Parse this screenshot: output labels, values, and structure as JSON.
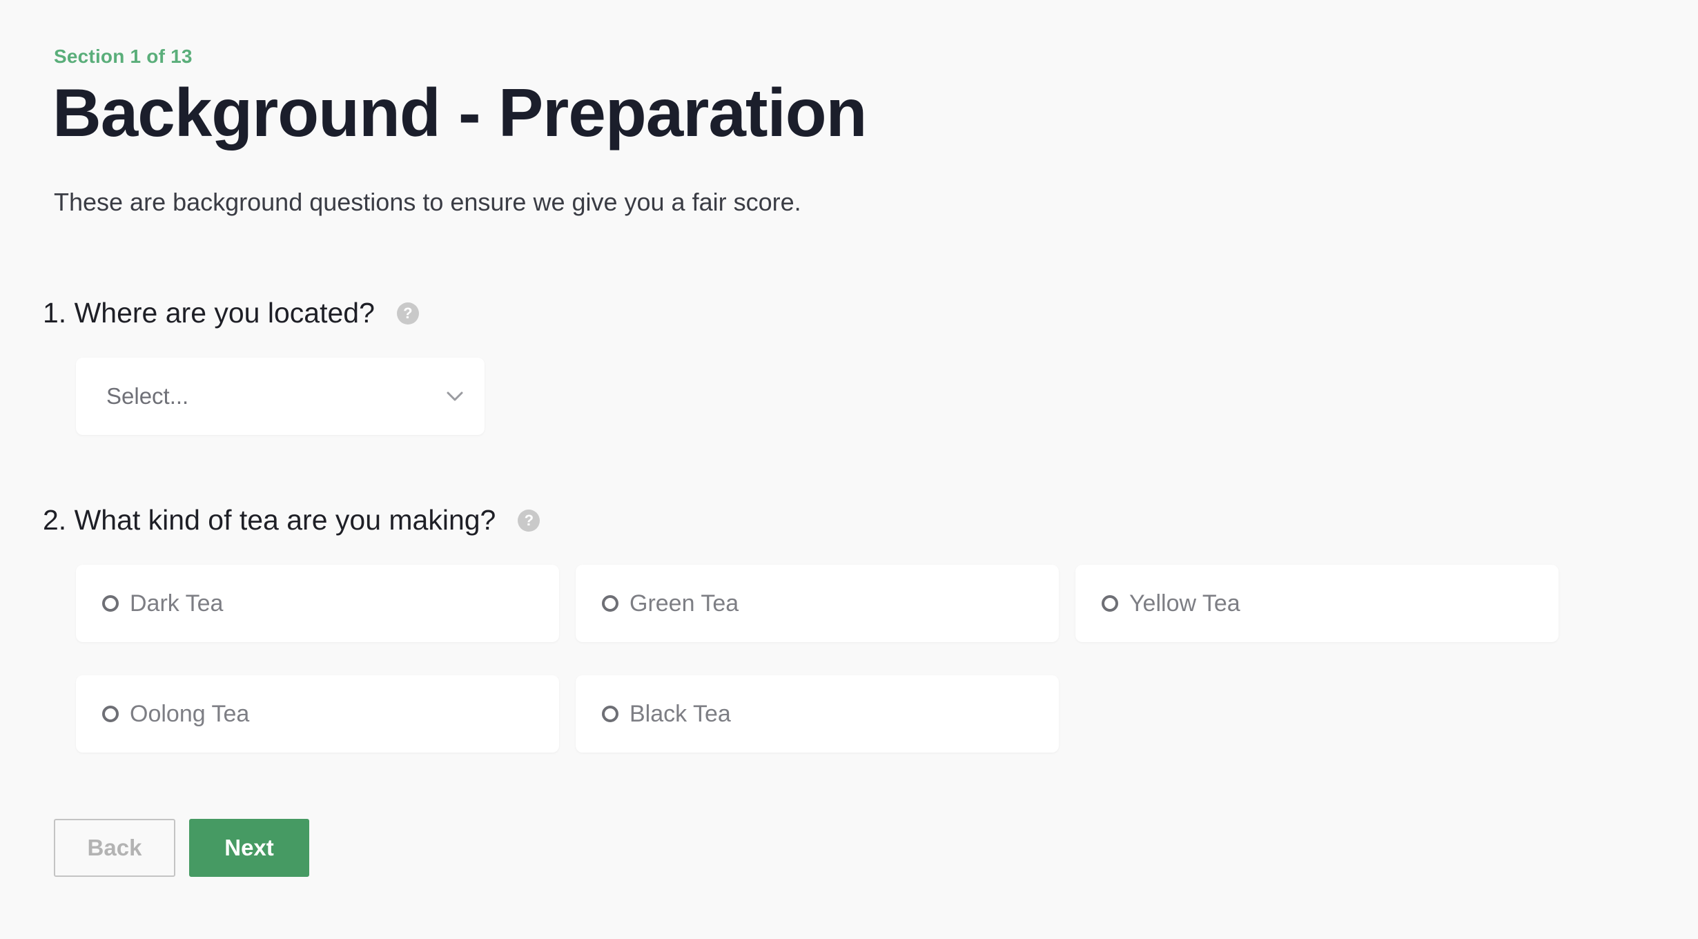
{
  "header": {
    "section_label": "Section 1 of 13",
    "title": "Background - Preparation",
    "subtitle": "These are background questions to ensure we give you a fair score."
  },
  "questions": [
    {
      "label": "1. Where are you located?",
      "help_icon": "question-circle-icon",
      "select": {
        "placeholder": "Select...",
        "icon": "chevron-down-icon"
      }
    },
    {
      "label": "2. What kind of tea are you making?",
      "help_icon": "question-circle-icon",
      "options": [
        "Dark Tea",
        "Green Tea",
        "Yellow Tea",
        "Oolong Tea",
        "Black Tea"
      ]
    }
  ],
  "actions": {
    "back_label": "Back",
    "next_label": "Next"
  },
  "colors": {
    "accent": "#469a63",
    "section_label": "#5aae7a",
    "background": "#f9f9f9",
    "title": "#1b1e2b"
  }
}
